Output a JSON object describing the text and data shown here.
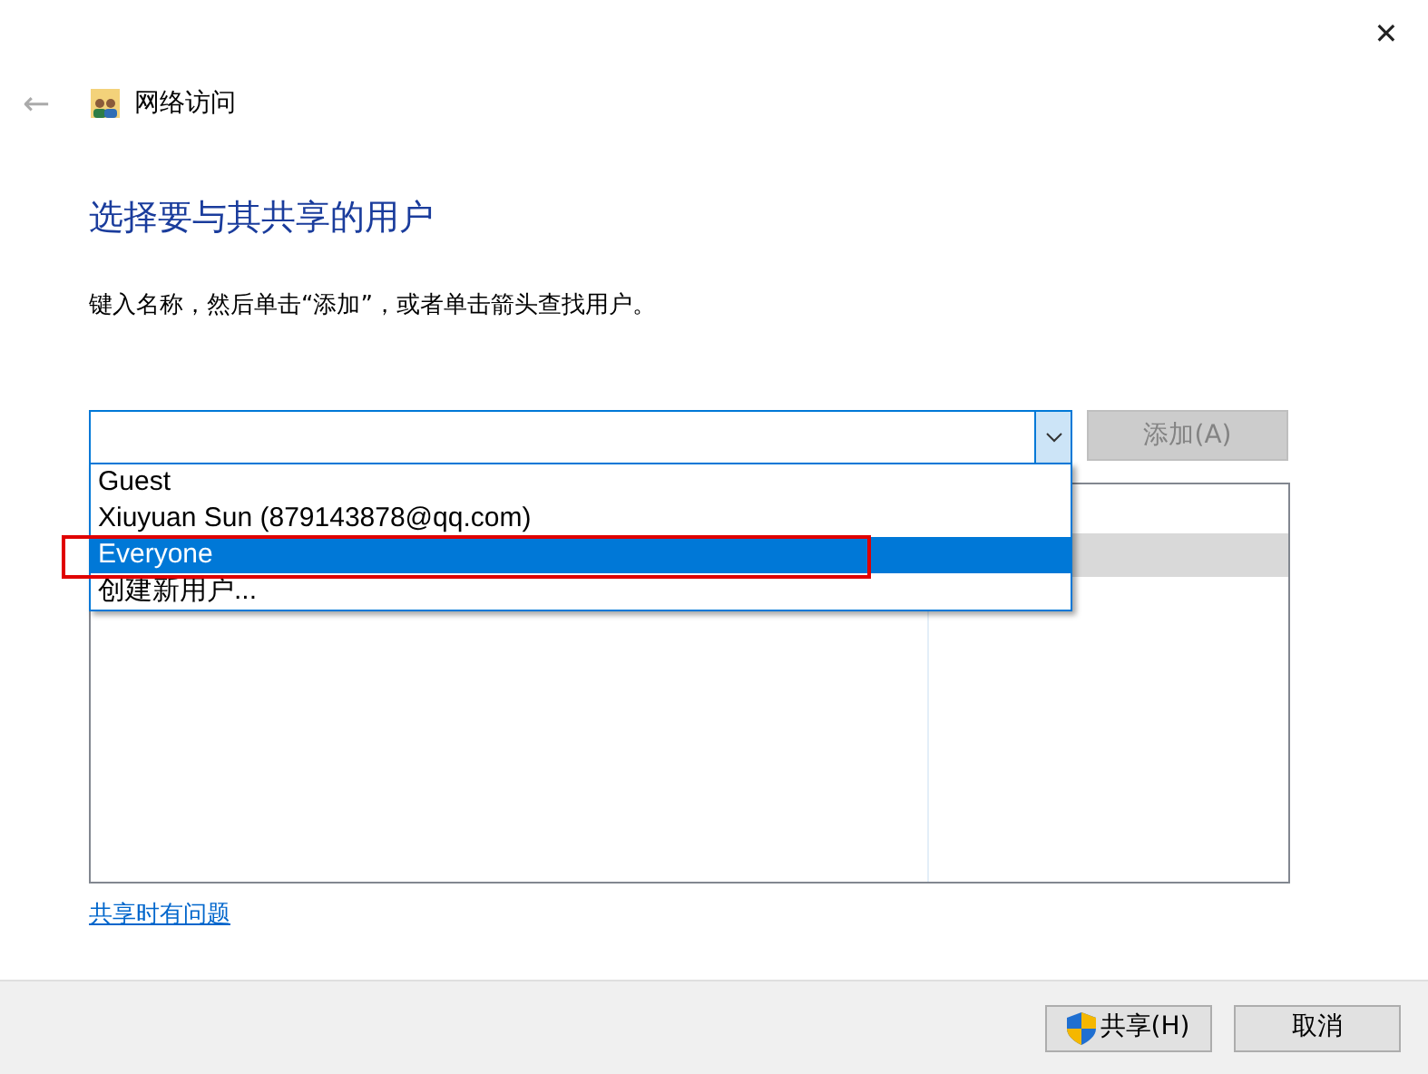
{
  "window": {
    "title": "网络访问",
    "close": "✕",
    "back": "←"
  },
  "heading": "选择要与其共享的用户",
  "instruction": "键入名称，然后单击“添加”，或者单击箭头查找用户。",
  "name_combo": {
    "expanded": true
  },
  "add_button": {
    "label": "添加(A)",
    "disabled": true
  },
  "dropdown": [
    {
      "label": "Guest",
      "selected": false
    },
    {
      "label": "Xiuyuan Sun (879143878@qq.com)",
      "selected": false
    },
    {
      "label": "Everyone",
      "selected": true
    },
    {
      "label": "创建新用户...",
      "selected": false
    }
  ],
  "help_link": "共享时有问题",
  "buttons": [
    {
      "label": "共享(H)",
      "kind": "shield"
    },
    {
      "label": "取消",
      "kind": "plain"
    }
  ]
}
